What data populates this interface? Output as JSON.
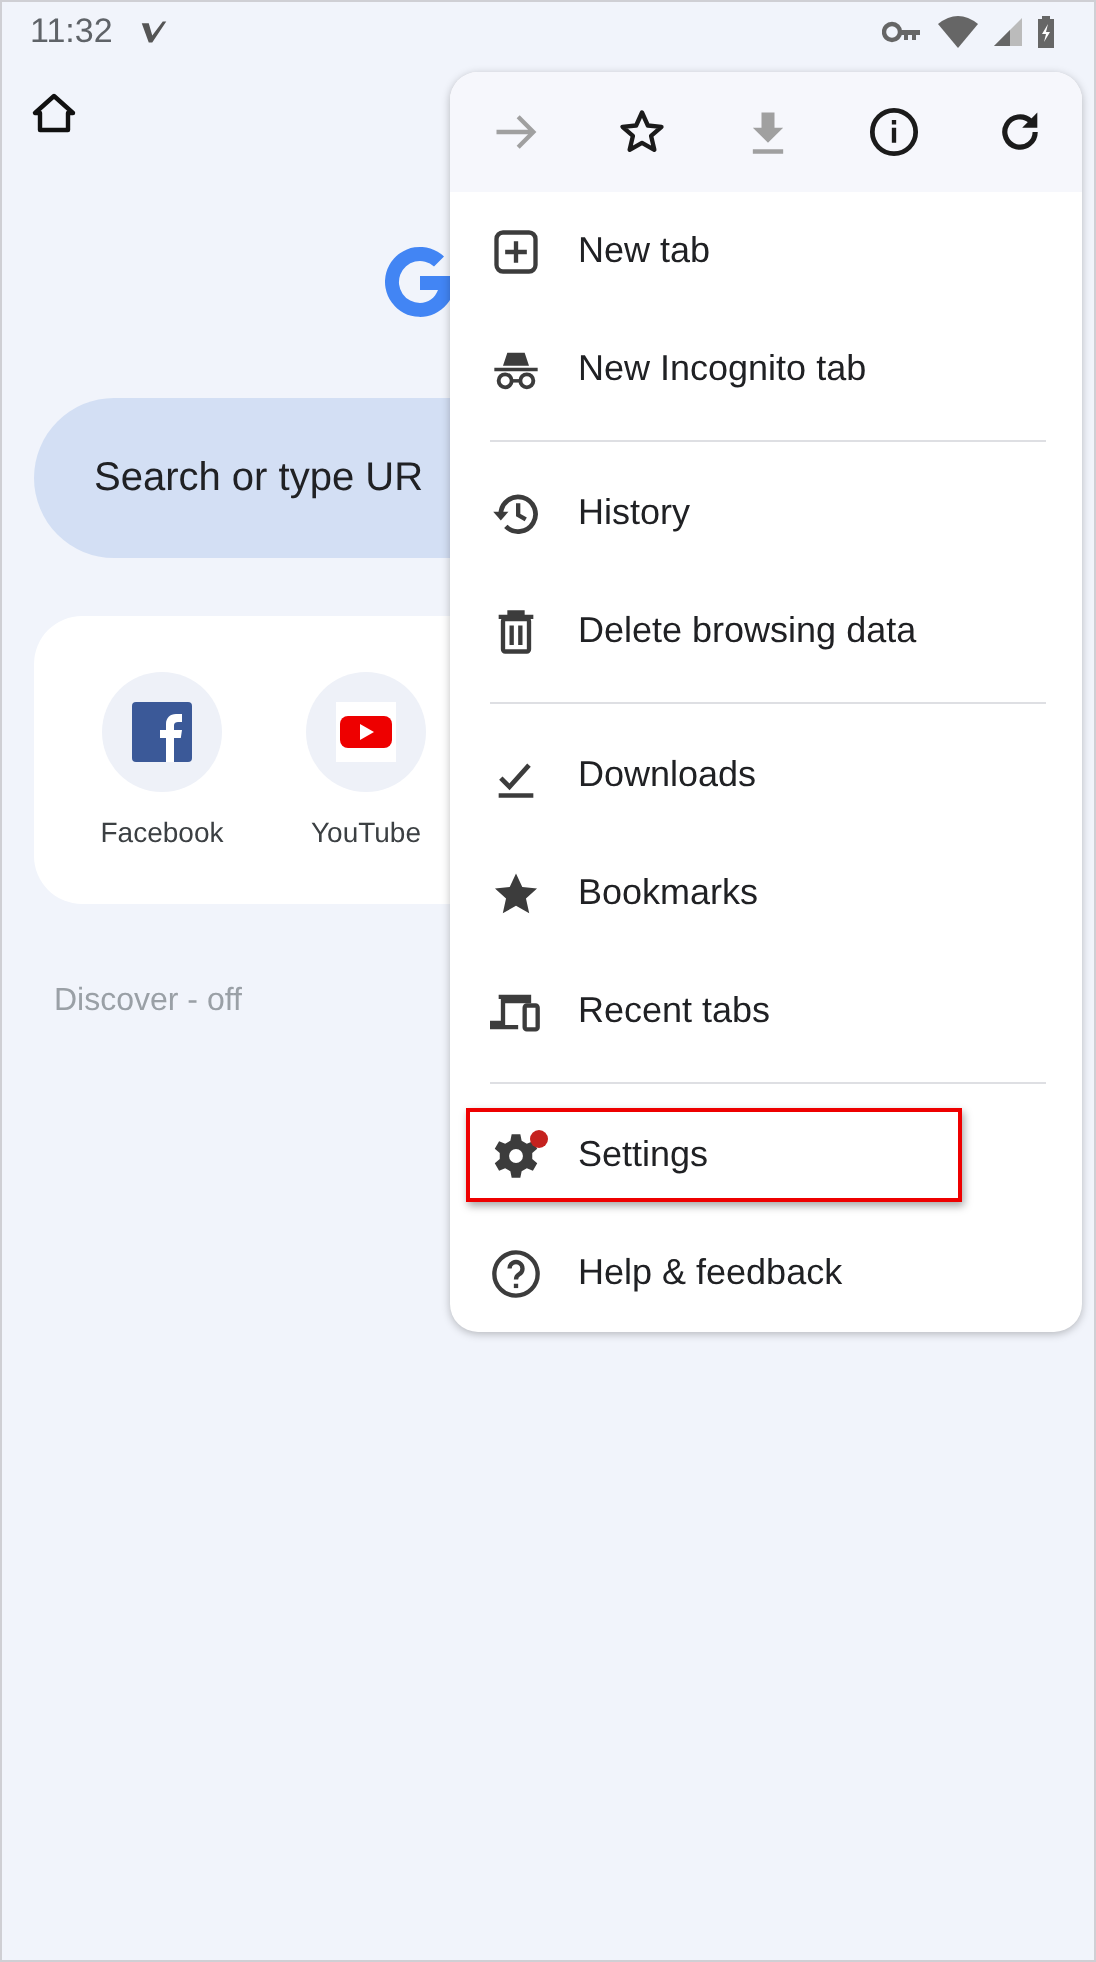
{
  "status_bar": {
    "time": "11:32"
  },
  "search": {
    "placeholder": "Search or type UR"
  },
  "shortcuts": [
    {
      "label": "Facebook",
      "kind": "facebook"
    },
    {
      "label": "YouTube",
      "kind": "youtube"
    }
  ],
  "discover": {
    "label": "Discover - off"
  },
  "menu": {
    "toolbar": [
      {
        "kind": "forward",
        "disabled": true
      },
      {
        "kind": "star",
        "disabled": false
      },
      {
        "kind": "download",
        "disabled": true
      },
      {
        "kind": "info",
        "disabled": false
      },
      {
        "kind": "reload",
        "disabled": false
      }
    ],
    "groups": [
      [
        {
          "label": "New tab",
          "kind": "plus",
          "badge": false,
          "highlighted": false
        },
        {
          "label": "New Incognito tab",
          "kind": "incognito",
          "badge": false,
          "highlighted": false
        }
      ],
      [
        {
          "label": "History",
          "kind": "history",
          "badge": false,
          "highlighted": false
        },
        {
          "label": "Delete browsing data",
          "kind": "trash",
          "badge": false,
          "highlighted": false
        }
      ],
      [
        {
          "label": "Downloads",
          "kind": "check",
          "badge": false,
          "highlighted": false
        },
        {
          "label": "Bookmarks",
          "kind": "starfill",
          "badge": false,
          "highlighted": false
        },
        {
          "label": "Recent tabs",
          "kind": "devices",
          "badge": false,
          "highlighted": false
        }
      ],
      [
        {
          "label": "Settings",
          "kind": "gear",
          "badge": true,
          "highlighted": true
        },
        {
          "label": "Help & feedback",
          "kind": "help",
          "badge": false,
          "highlighted": false
        }
      ]
    ]
  }
}
